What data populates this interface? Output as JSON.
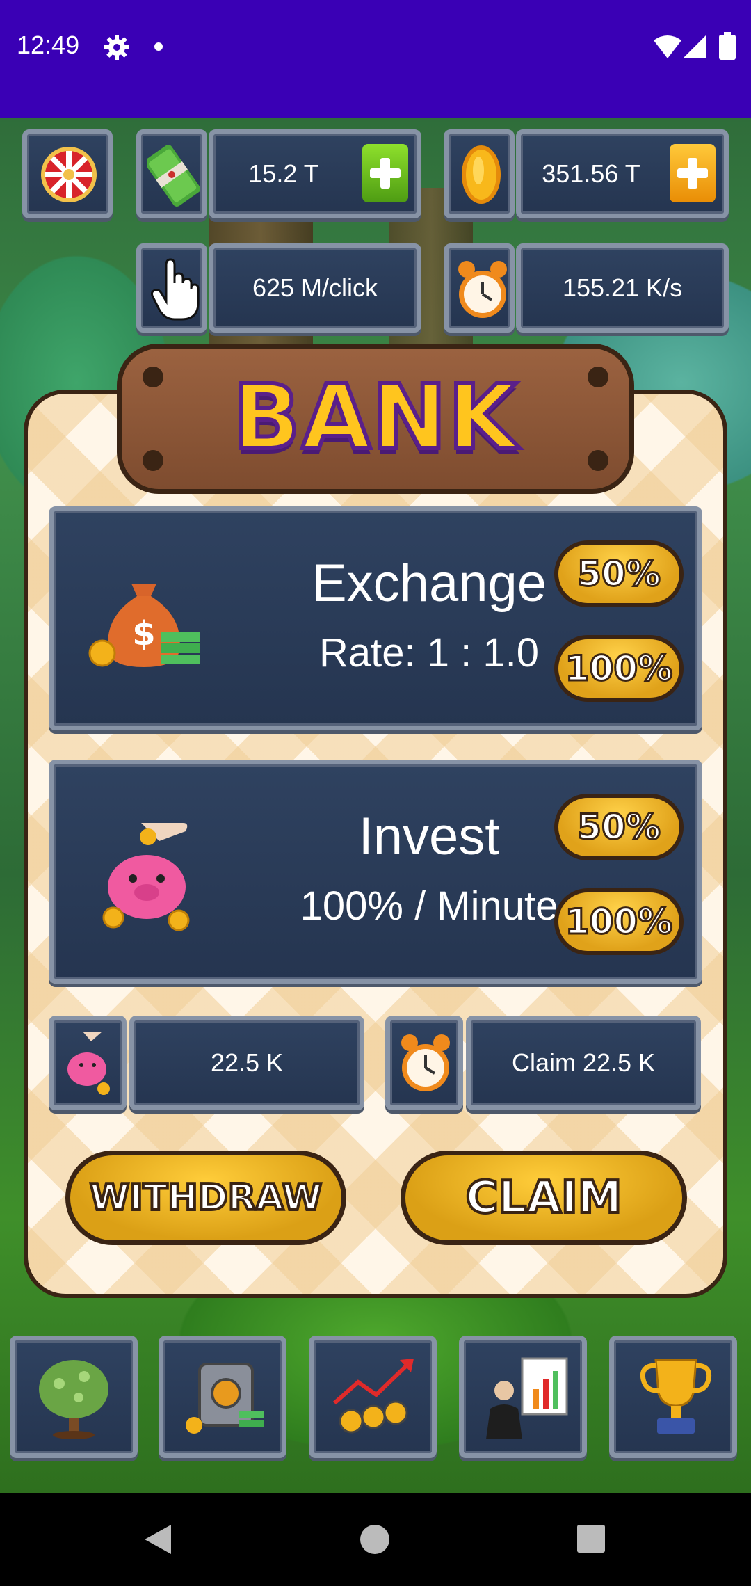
{
  "status_bar": {
    "time": "12:49"
  },
  "stats": {
    "cash": "15.2 T",
    "coins": "351.56 T",
    "per_click": "625 M/click",
    "per_second": "155.21 K/s"
  },
  "bank": {
    "title": "BANK",
    "exchange": {
      "title": "Exchange",
      "rate": "Rate: 1 : 1.0",
      "btn_50": "50%",
      "btn_100": "100%"
    },
    "invest": {
      "title": "Invest",
      "rate": "100% / Minute",
      "btn_50": "50%",
      "btn_100": "100%"
    },
    "invested_amount": "22.5 K",
    "claim_amount": "Claim 22.5 K",
    "withdraw_label": "WITHDRAW",
    "claim_label": "CLAIM"
  },
  "nav": [
    {
      "icon": "money-tree-icon"
    },
    {
      "icon": "safe-icon"
    },
    {
      "icon": "investment-chart-icon"
    },
    {
      "icon": "presentation-icon"
    },
    {
      "icon": "trophy-icon"
    }
  ],
  "colors": {
    "status_bar": "#3a00b5",
    "panel": "#2f4260",
    "gold": "#ffc51e",
    "green_plus": "#6cbf1c",
    "orange_plus": "#f5a50f"
  }
}
